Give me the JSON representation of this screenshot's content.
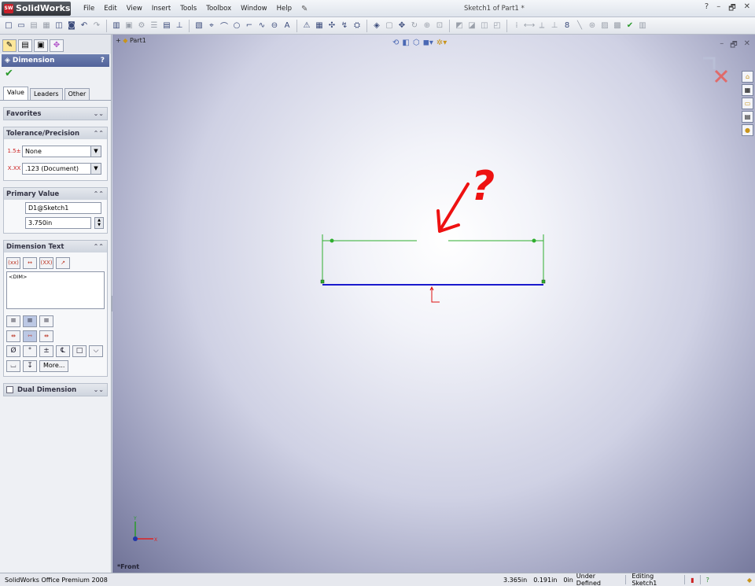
{
  "app": {
    "logo": "SolidWorks",
    "logo_badge": "SW",
    "document_title": "Sketch1 of Part1 *"
  },
  "menu": [
    "File",
    "Edit",
    "View",
    "Insert",
    "Tools",
    "Toolbox",
    "Window",
    "Help"
  ],
  "window_controls": [
    "?",
    "–",
    "🗗",
    "✕"
  ],
  "property_manager": {
    "title": "Dimension",
    "help": "?",
    "ok_symbol": "✔",
    "tabs": [
      "Value",
      "Leaders",
      "Other"
    ],
    "active_tab": "Value",
    "groups": {
      "favorites": "Favorites",
      "tolerance": "Tolerance/Precision",
      "primary": "Primary Value",
      "dimension_text": "Dimension Text",
      "dual": "Dual Dimension"
    },
    "tolerance_type": "None",
    "precision": ".123 (Document)",
    "primary_name": "D1@Sketch1",
    "primary_value": "3.750in",
    "dim_text": "<DIM>",
    "more_button": "More..."
  },
  "viewport": {
    "tree_item": "Part1",
    "view_name": "*Front",
    "annotation_text": "?",
    "colors": {
      "sketch_line": "#1a1acd",
      "dimension": "#2fae2f",
      "annotation": "#ee1111"
    }
  },
  "status_bar": {
    "product": "SolidWorks Office Premium 2008",
    "x": "3.365in",
    "y": "0.191in",
    "z": "0in",
    "state": "Under Defined",
    "editing": "Editing Sketch1"
  }
}
